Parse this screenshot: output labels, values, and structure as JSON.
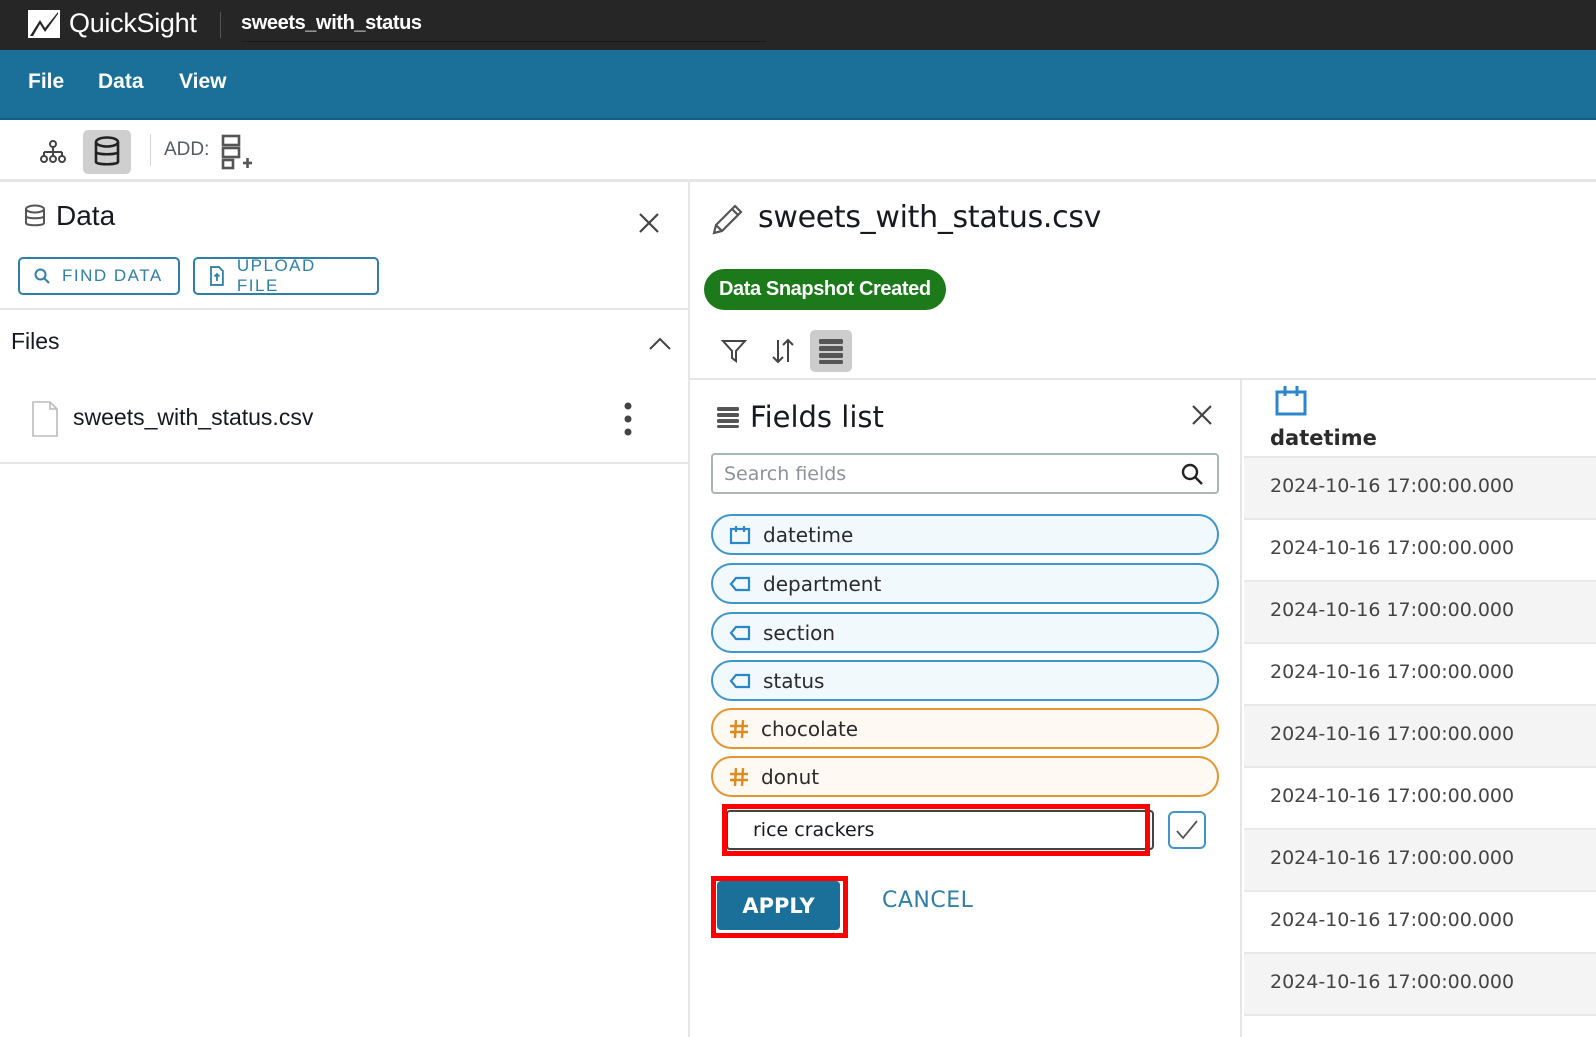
{
  "app": {
    "brand": "QuickSight",
    "analysis_title": "sweets_with_status"
  },
  "menu": {
    "items": [
      "File",
      "Data",
      "View"
    ]
  },
  "toolbar": {
    "add_label": "ADD:"
  },
  "data_panel": {
    "title": "Data",
    "find_data_label": "FIND DATA",
    "upload_file_label": "UPLOAD FILE",
    "files_section_label": "Files",
    "files": [
      {
        "name": "sweets_with_status.csv"
      }
    ]
  },
  "dataset": {
    "title": "sweets_with_status.csv",
    "status_badge": "Data Snapshot Created",
    "colors": {
      "badge": "#1d7a1a",
      "accent": "#1a7099",
      "dimension": "#3f95cc",
      "measure": "#e39530",
      "highlight": "#ff0000"
    }
  },
  "fields_list": {
    "title": "Fields list",
    "search_placeholder": "Search fields",
    "fields": [
      {
        "name": "datetime",
        "type": "date",
        "icon": "calendar-icon"
      },
      {
        "name": "department",
        "type": "dimension",
        "icon": "tag-icon"
      },
      {
        "name": "section",
        "type": "dimension",
        "icon": "tag-icon"
      },
      {
        "name": "status",
        "type": "dimension",
        "icon": "tag-icon"
      },
      {
        "name": "chocolate",
        "type": "measure",
        "icon": "hash-icon"
      },
      {
        "name": "donut",
        "type": "measure",
        "icon": "hash-icon"
      }
    ],
    "rename_value": "rice crackers",
    "apply_label": "APPLY",
    "cancel_label": "CANCEL"
  },
  "table": {
    "column_header": "datetime",
    "column_icon": "calendar-icon",
    "rows": [
      "2024-10-16 17:00:00.000",
      "2024-10-16 17:00:00.000",
      "2024-10-16 17:00:00.000",
      "2024-10-16 17:00:00.000",
      "2024-10-16 17:00:00.000",
      "2024-10-16 17:00:00.000",
      "2024-10-16 17:00:00.000",
      "2024-10-16 17:00:00.000",
      "2024-10-16 17:00:00.000"
    ]
  }
}
